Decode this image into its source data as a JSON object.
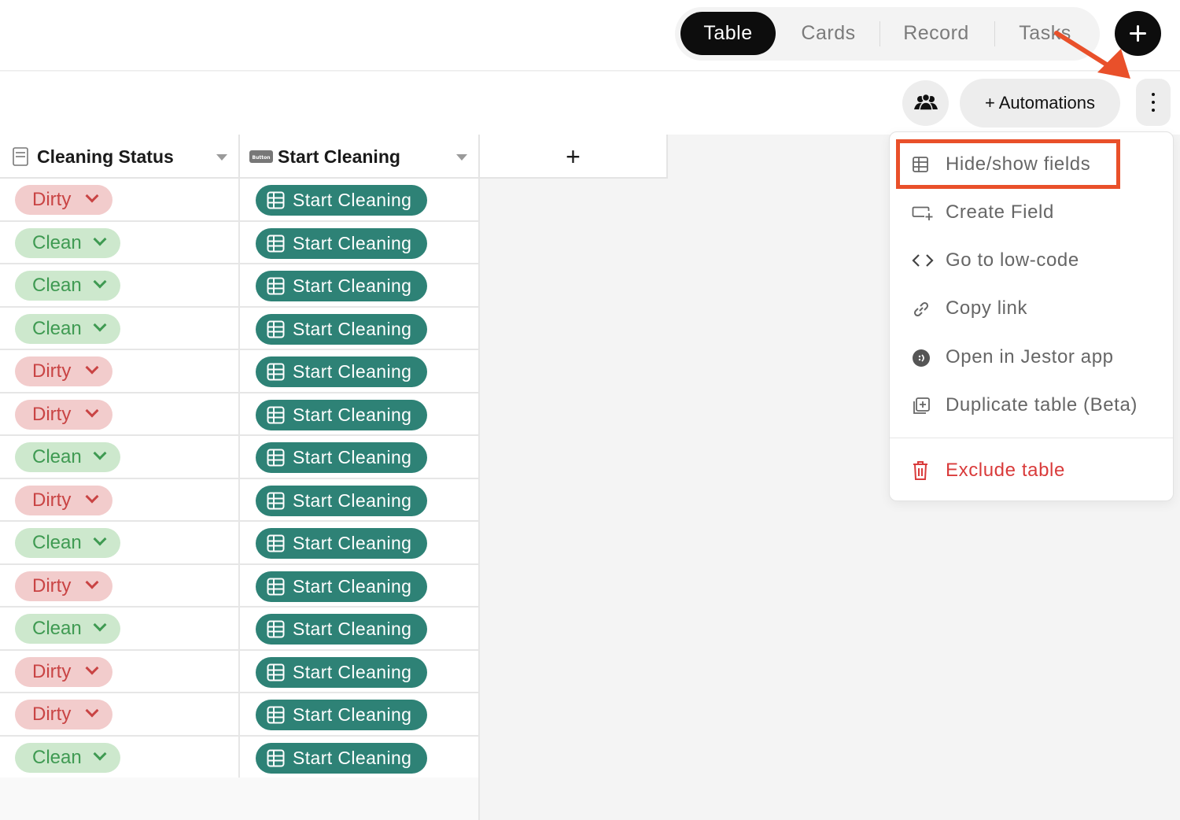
{
  "view_tabs": [
    {
      "label": "Table",
      "active": true
    },
    {
      "label": "Cards",
      "active": false
    },
    {
      "label": "Record",
      "active": false
    },
    {
      "label": "Tasks",
      "active": false
    }
  ],
  "toolbar": {
    "automations_label": "+ Automations"
  },
  "table": {
    "columns": [
      {
        "label": "Cleaning Status",
        "icon": "single-select-field-icon"
      },
      {
        "label": "Start Cleaning",
        "icon": "button-field-icon",
        "icon_text": "Button"
      }
    ],
    "add_column_label": "+",
    "rows": [
      {
        "status": "Dirty",
        "action": "Start Cleaning"
      },
      {
        "status": "Clean",
        "action": "Start Cleaning"
      },
      {
        "status": "Clean",
        "action": "Start Cleaning"
      },
      {
        "status": "Clean",
        "action": "Start Cleaning"
      },
      {
        "status": "Dirty",
        "action": "Start Cleaning"
      },
      {
        "status": "Dirty",
        "action": "Start Cleaning"
      },
      {
        "status": "Clean",
        "action": "Start Cleaning"
      },
      {
        "status": "Dirty",
        "action": "Start Cleaning"
      },
      {
        "status": "Clean",
        "action": "Start Cleaning"
      },
      {
        "status": "Dirty",
        "action": "Start Cleaning"
      },
      {
        "status": "Clean",
        "action": "Start Cleaning"
      },
      {
        "status": "Dirty",
        "action": "Start Cleaning"
      },
      {
        "status": "Dirty",
        "action": "Start Cleaning"
      },
      {
        "status": "Clean",
        "action": "Start Cleaning"
      }
    ]
  },
  "menu": {
    "items": [
      {
        "label": "Hide/show fields",
        "icon": "table-icon",
        "highlighted": true
      },
      {
        "label": "Create Field",
        "icon": "create-field-icon"
      },
      {
        "label": "Go to low-code",
        "icon": "code-icon"
      },
      {
        "label": "Copy link",
        "icon": "link-icon"
      },
      {
        "label": "Open in Jestor app",
        "icon": "jestor-app-icon"
      },
      {
        "label": "Duplicate table (Beta)",
        "icon": "duplicate-icon"
      }
    ],
    "danger_item": {
      "label": "Exclude table",
      "icon": "trash-icon"
    }
  },
  "colors": {
    "dirty_bg": "#f2cccc",
    "dirty_text": "#c94444",
    "clean_bg": "#cde8cd",
    "clean_text": "#3f9a52",
    "action_bg": "#2e8276",
    "annotation": "#e9502a"
  }
}
